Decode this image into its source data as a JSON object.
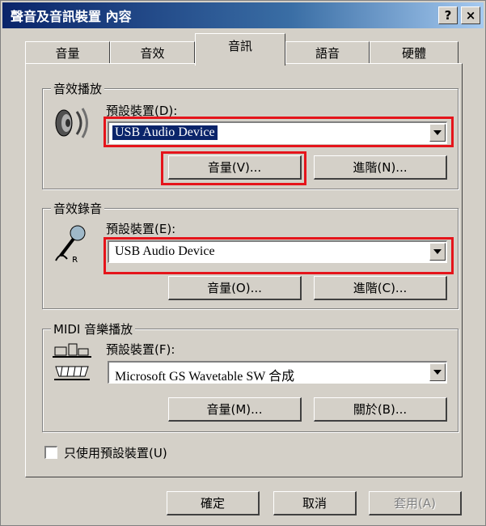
{
  "window": {
    "title": "聲音及音訊裝置 內容",
    "help_btn": "?",
    "close_btn": "×"
  },
  "tabs": [
    {
      "label": "音量"
    },
    {
      "label": "音效"
    },
    {
      "label": "音訊"
    },
    {
      "label": "語音"
    },
    {
      "label": "硬體"
    }
  ],
  "playback": {
    "legend": "音效播放",
    "device_label": "預設裝置(D):",
    "device_value": "USB Audio Device",
    "volume_btn": "音量(V)...",
    "advanced_btn": "進階(N)..."
  },
  "recording": {
    "legend": "音效錄音",
    "device_label": "預設裝置(E):",
    "device_value": "USB Audio Device",
    "volume_btn": "音量(O)...",
    "advanced_btn": "進階(C)..."
  },
  "midi": {
    "legend": "MIDI 音樂播放",
    "device_label": "預設裝置(F):",
    "device_value": "Microsoft GS Wavetable SW 合成",
    "volume_btn": "音量(M)...",
    "about_btn": "關於(B)..."
  },
  "use_default_only": {
    "label": "只使用預設裝置(U)",
    "checked": false
  },
  "footer": {
    "ok": "確定",
    "cancel": "取消",
    "apply": "套用(A)"
  },
  "colors": {
    "highlight": "#e5141b",
    "selection": "#0a246a",
    "face": "#d4d0c8"
  }
}
